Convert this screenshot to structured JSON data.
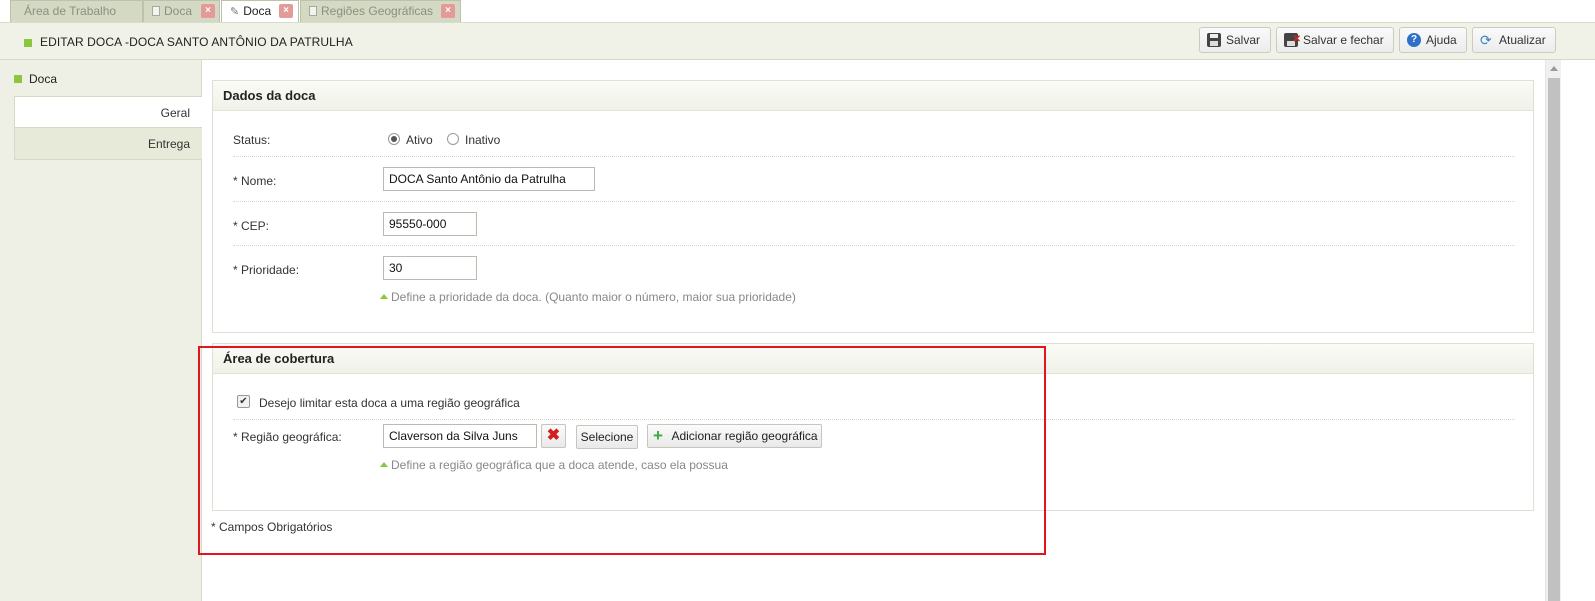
{
  "tabs": [
    {
      "label": "Área de Trabalho",
      "closable": false,
      "active": false
    },
    {
      "label": "Doca",
      "closable": true,
      "active": false
    },
    {
      "label": "Doca",
      "closable": true,
      "active": true
    },
    {
      "label": "Regiões Geográficas",
      "closable": true,
      "active": false
    }
  ],
  "tab_close_glyph": "×",
  "header": {
    "title": "EDITAR DOCA -DOCA SANTO ANTÔNIO DA PATRULHA",
    "buttons": {
      "save": "Salvar",
      "save_close": "Salvar e fechar",
      "help": "Ajuda",
      "refresh": "Atualizar"
    },
    "help_glyph": "?",
    "refresh_glyph": "⟳"
  },
  "sidebar": {
    "title": "Doca",
    "items": [
      {
        "label": "Geral",
        "active": true
      },
      {
        "label": "Entrega",
        "active": false
      }
    ]
  },
  "dados": {
    "title": "Dados da doca",
    "status_label": "Status:",
    "status_options": [
      "Ativo",
      "Inativo"
    ],
    "status_selected": "Ativo",
    "nome_label": "* Nome:",
    "nome_value": "DOCA Santo Antônio da Patrulha",
    "cep_label": "* CEP:",
    "cep_value": "95550-000",
    "prioridade_label": "* Prioridade:",
    "prioridade_value": "30",
    "prioridade_hint": "Define a prioridade da doca. (Quanto maior o número, maior sua prioridade)"
  },
  "cobertura": {
    "title": "Área de cobertura",
    "limit_checkbox_label": "Desejo limitar esta doca a uma região geográfica",
    "limit_checked": true,
    "check_glyph": "✔",
    "regiao_label": "* Região geográfica:",
    "regiao_value": "Claverson da Silva Juns",
    "remove_glyph": "✖",
    "select_button": "Selecione",
    "add_button": "Adicionar região geográfica",
    "add_glyph": "+",
    "regiao_hint": "Define a região geográfica que a doca atende, caso ela possua"
  },
  "footnote": "* Campos Obrigatórios",
  "colors": {
    "accent_green": "#8cc63f",
    "highlight_red": "#e0161f",
    "tab_bg": "#d4d9c4"
  }
}
